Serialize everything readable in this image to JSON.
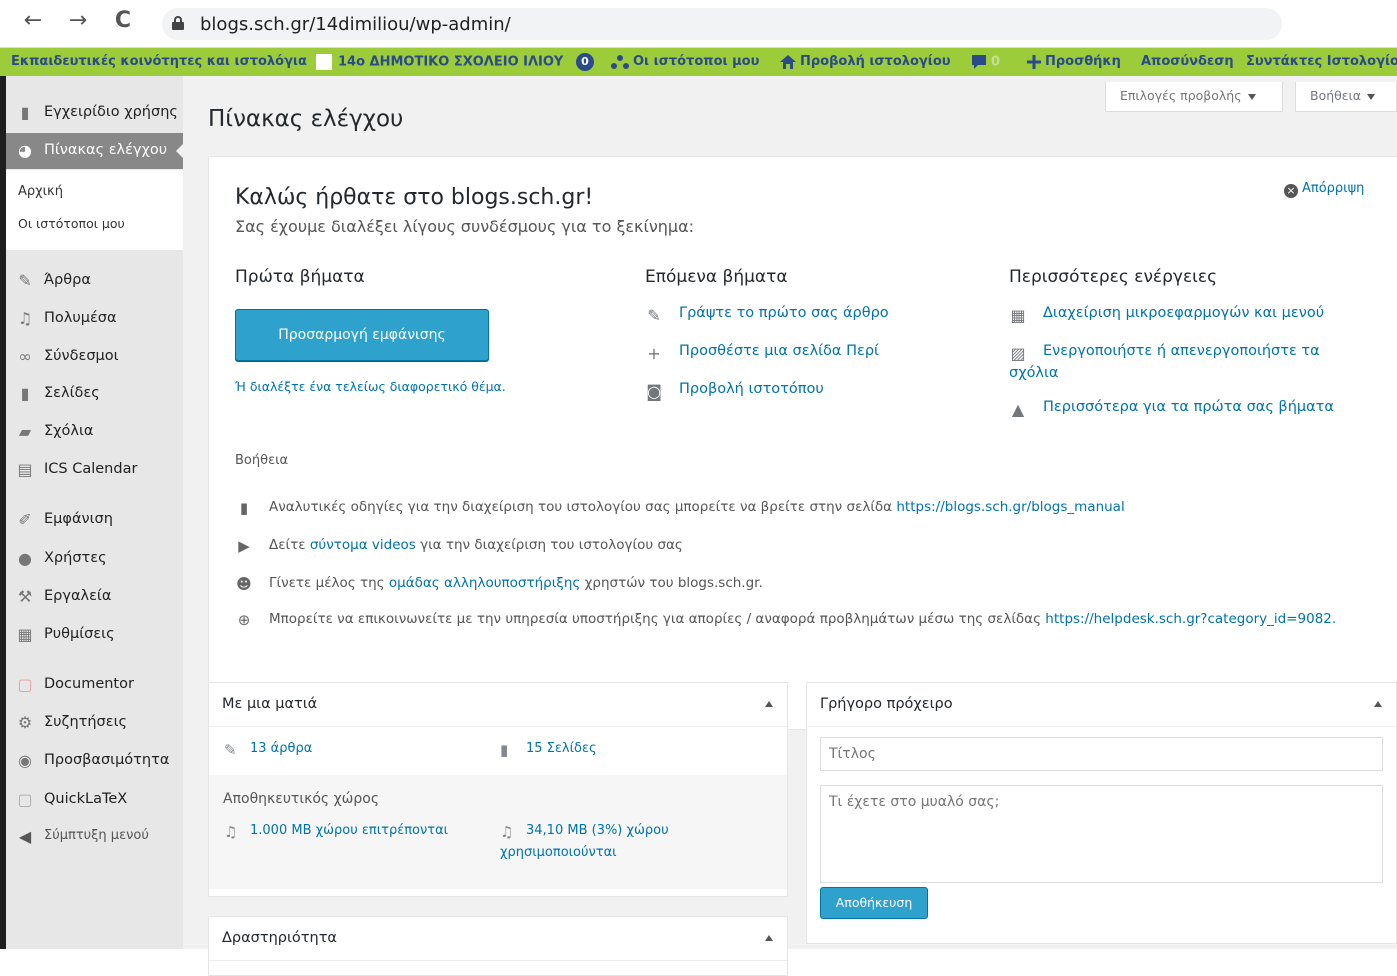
{
  "browser": {
    "back_icon": "←",
    "forward_icon": "→",
    "reload_icon": "C",
    "url": "blogs.sch.gr/14dimiliou/wp-admin/"
  },
  "admin_bar": {
    "communities": "Εκπαιδευτικές κοινότητες και ιστολόγια",
    "site_name": "14ο ΔΗΜΟΤΙΚΟ ΣΧΟΛΕΙΟ ΙΛΙΟΥ",
    "updates_count": "0",
    "my_sites": "Οι ιστότοποι μου",
    "view_blog": "Προβολή ιστολογίου",
    "comments_count": "0",
    "add_new": "Προσθήκη",
    "logout": "Αποσύνδεση",
    "blog_editors": "Συντάκτες Ιστολογίου",
    "accent_color": "#9ccc3a"
  },
  "sidebar": {
    "manual": "Εγχειρίδιο χρήσης",
    "dashboard": "Πίνακας ελέγχου",
    "sub_home": "Αρχική",
    "sub_my_sites": "Οι ιστότοποι μου",
    "posts": "Άρθρα",
    "media": "Πολυμέσα",
    "links": "Σύνδεσμοι",
    "pages": "Σελίδες",
    "comments": "Σχόλια",
    "ics_calendar": "ICS Calendar",
    "appearance": "Εμφάνιση",
    "users": "Χρήστες",
    "tools": "Εργαλεία",
    "settings": "Ρυθμίσεις",
    "documentor": "Documentor",
    "discussions": "Συζητήσεις",
    "accessibility": "Προσβασιμότητα",
    "quicklatex": "QuickLaTeX",
    "collapse_menu": "Σύμπτυξη μενού"
  },
  "main": {
    "page_title": "Πίνακας ελέγχου",
    "screen_options": "Επιλογές προβολής",
    "help_tab": "Βοήθεια"
  },
  "welcome": {
    "title": "Καλώς ήρθατε στο blogs.sch.gr!",
    "subtitle": "Σας έχουμε διαλέξει λίγους συνδέσμους για το ξεκίνημα:",
    "dismiss": "Απόρριψη",
    "first_steps": "Πρώτα βήματα",
    "customize_button": "Προσαρμογή εμφάνισης",
    "alt_theme": "Ή διαλέξτε ένα τελείως διαφορετικό θέμα.",
    "next_steps": "Επόμενα βήματα",
    "write_post": "Γράψτε το πρώτο σας άρθρο",
    "add_about": "Προσθέστε μια σελίδα Περί",
    "view_site": "Προβολή ιστοτόπου",
    "more_actions": "Περισσότερες ενέργειες",
    "manage_widgets": "Διαχείριση μικροεφαρμογών και μενού",
    "toggle_comments_1": "Ενεργοποιήστε ή απενεργοποιήστε τα",
    "toggle_comments_2": "σχόλια",
    "learn_more": "Περισσότερα για τα πρώτα σας βήματα",
    "help_label": "Βοήθεια",
    "help1_text": "Αναλυτικές οδηγίες για την διαχείριση του ιστολογίου σας μπορείτε να βρείτε στην σελίδα ",
    "help1_link": "https://blogs.sch.gr/blogs_manual",
    "help2_pre": "Δείτε ",
    "help2_link": "σύντομα videos",
    "help2_post": " για την διαχείριση του ιστολογίου σας",
    "help3_pre": "Γίνετε μέλος της ",
    "help3_link": "ομάδας αλληλουποστήριξης",
    "help3_post": " χρηστών του blogs.sch.gr.",
    "help4_text": "Μπορείτε να επικοινωνείτε με την υπηρεσία υποστήριξης για απορίες / αναφορά προβλημάτων μέσω της σελίδας ",
    "help4_link": "https://helpdesk.sch.gr?category_id=9082."
  },
  "glance": {
    "title": "Με μια ματιά",
    "posts": "13 άρθρα",
    "pages": "15 Σελίδες",
    "storage_label": "Αποθηκευτικός χώρος",
    "allowed": "1.000 MB χώρου επιτρέπονται",
    "used_1": "34,10 MB (3%) χώρου",
    "used_2": "χρησιμοποιούνται"
  },
  "quick_draft": {
    "title": "Γρήγορο πρόχειρο",
    "title_placeholder": "Τίτλος",
    "content_placeholder": "Τι έχετε στο μυαλό σας;",
    "save": "Αποθήκευση"
  },
  "activity": {
    "title": "Δραστηριότητα"
  }
}
